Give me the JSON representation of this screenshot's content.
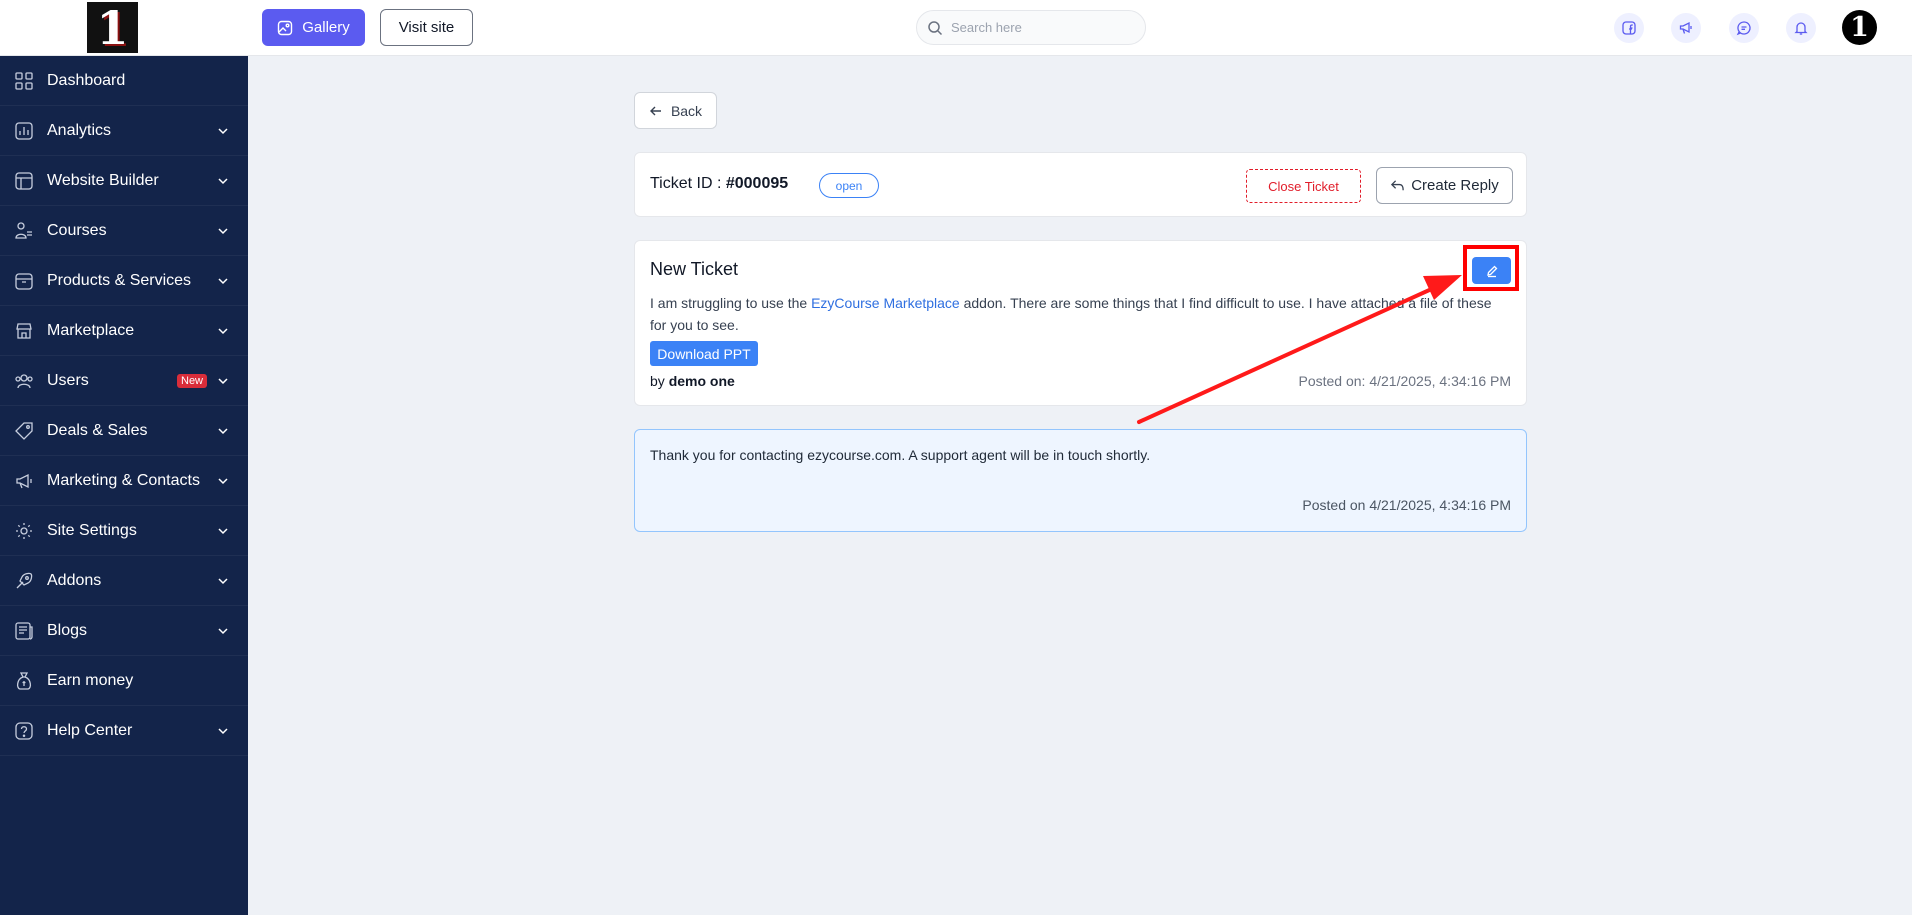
{
  "header": {
    "logo_text": "1",
    "gallery_label": "Gallery",
    "visit_site_label": "Visit site",
    "search_placeholder": "Search here",
    "avatar_text": "1"
  },
  "sidebar": {
    "items": [
      {
        "label": "Dashboard",
        "icon": "dashboard-icon",
        "has_chevron": false
      },
      {
        "label": "Analytics",
        "icon": "analytics-icon",
        "has_chevron": true
      },
      {
        "label": "Website Builder",
        "icon": "website-builder-icon",
        "has_chevron": true
      },
      {
        "label": "Courses",
        "icon": "courses-icon",
        "has_chevron": true
      },
      {
        "label": "Products & Services",
        "icon": "products-icon",
        "has_chevron": true
      },
      {
        "label": "Marketplace",
        "icon": "marketplace-icon",
        "has_chevron": true
      },
      {
        "label": "Users",
        "icon": "users-icon",
        "has_chevron": true,
        "badge": "New"
      },
      {
        "label": "Deals & Sales",
        "icon": "tag-icon",
        "has_chevron": true
      },
      {
        "label": "Marketing & Contacts",
        "icon": "megaphone-icon",
        "has_chevron": true
      },
      {
        "label": "Site Settings",
        "icon": "gear-icon",
        "has_chevron": true
      },
      {
        "label": "Addons",
        "icon": "addons-icon",
        "has_chevron": true
      },
      {
        "label": "Blogs",
        "icon": "blogs-icon",
        "has_chevron": true
      },
      {
        "label": "Earn money",
        "icon": "money-bag-icon",
        "has_chevron": false
      },
      {
        "label": "Help Center",
        "icon": "help-icon",
        "has_chevron": true
      }
    ]
  },
  "main": {
    "back_label": "Back",
    "ticket": {
      "id_label": "Ticket ID : ",
      "id_value": "#000095",
      "status": "open",
      "close_label": "Close Ticket",
      "reply_label": "Create Reply"
    },
    "message": {
      "title": "New Ticket",
      "text_before_link": "I am struggling to use the ",
      "link_text": "EzyCourse Marketplace",
      "text_after_link": " addon. There are some things that I find difficult to use. I have attached a file of these for you to see.",
      "download_label": "Download PPT",
      "by_prefix": "by ",
      "author": "demo one",
      "posted": "Posted on: 4/21/2025, 4:34:16 PM"
    },
    "reply": {
      "text": "Thank you for contacting ezycourse.com. A support agent will be in touch shortly.",
      "posted": "Posted on 4/21/2025, 4:34:16 PM"
    }
  },
  "colors": {
    "sidebar_bg": "#13244a",
    "primary": "#5b5bf0",
    "accent_blue": "#3b82f6",
    "danger": "#e11d2a",
    "annotation": "#ff0000"
  }
}
